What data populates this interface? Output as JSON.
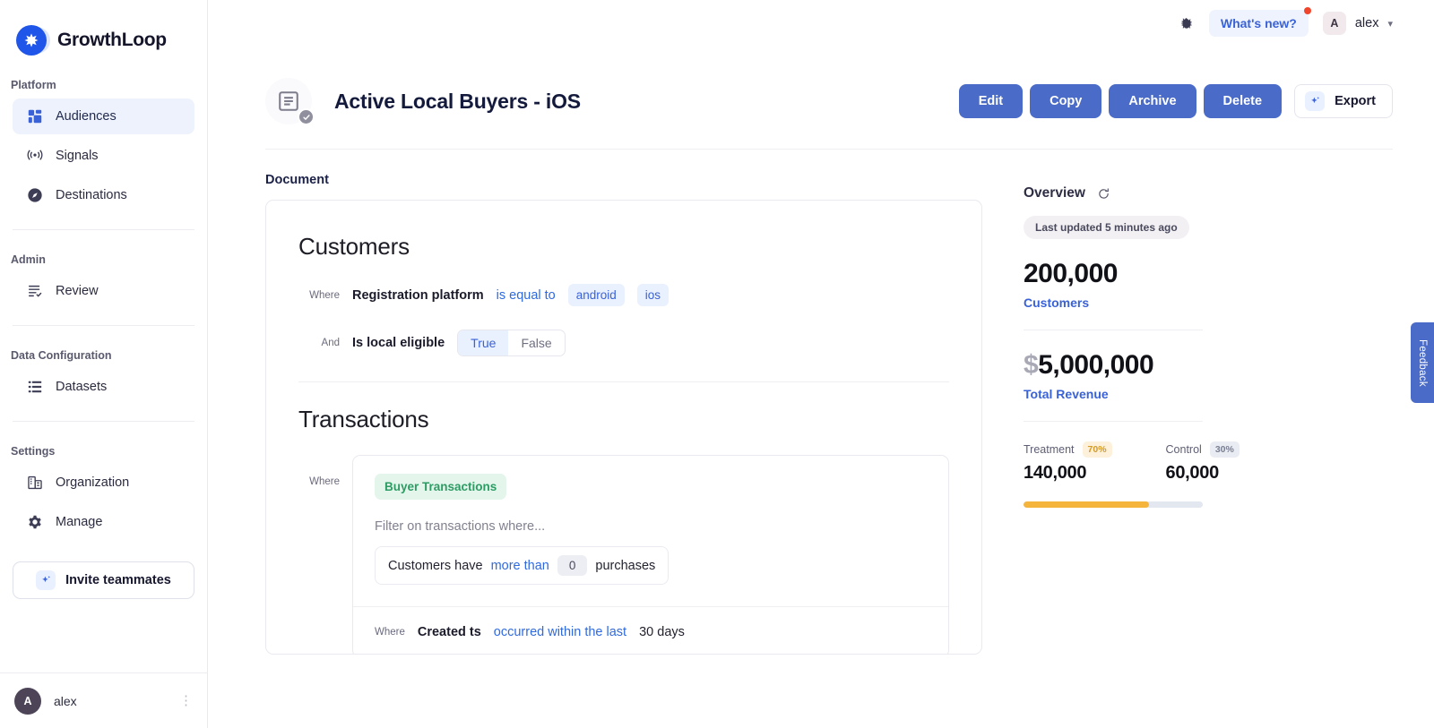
{
  "brand": {
    "name": "GrowthLoop",
    "logo_icon": "sparkle-icon"
  },
  "sidebar": {
    "sections": [
      {
        "label": "Platform",
        "items": [
          {
            "label": "Audiences",
            "icon": "grid-icon",
            "active": true
          },
          {
            "label": "Signals",
            "icon": "broadcast-icon",
            "active": false
          },
          {
            "label": "Destinations",
            "icon": "compass-icon",
            "active": false
          }
        ]
      },
      {
        "label": "Admin",
        "items": [
          {
            "label": "Review",
            "icon": "checklist-icon",
            "active": false
          }
        ]
      },
      {
        "label": "Data Configuration",
        "items": [
          {
            "label": "Datasets",
            "icon": "list-icon",
            "active": false
          }
        ]
      },
      {
        "label": "Settings",
        "items": [
          {
            "label": "Organization",
            "icon": "building-icon",
            "active": false
          },
          {
            "label": "Manage",
            "icon": "gear-icon",
            "active": false
          }
        ]
      }
    ],
    "invite_label": "Invite teammates",
    "footer_user": {
      "initial": "A",
      "name": "alex"
    }
  },
  "topbar": {
    "bug_icon": "bug-icon",
    "whats_new_label": "What's new?",
    "user": {
      "initial": "A",
      "name": "alex"
    }
  },
  "page": {
    "title": "Active Local Buyers - iOS",
    "doc_icon": "document-icon",
    "status_icon": "check-circle-icon",
    "actions": [
      {
        "label": "Edit",
        "style": "primary"
      },
      {
        "label": "Copy",
        "style": "primary"
      },
      {
        "label": "Archive",
        "style": "primary"
      },
      {
        "label": "Delete",
        "style": "primary"
      }
    ],
    "export_label": "Export"
  },
  "document": {
    "section_label": "Document",
    "customers": {
      "title": "Customers",
      "conditions": [
        {
          "keyword": "Where",
          "field": "Registration platform",
          "operator": "is equal to",
          "values": [
            "android",
            "ios"
          ]
        },
        {
          "keyword": "And",
          "field": "Is local eligible",
          "toggle": {
            "on": "True",
            "off": "False",
            "selected": "True"
          }
        }
      ]
    },
    "transactions": {
      "title": "Transactions",
      "keyword": "Where",
      "entity_pill": "Buyer Transactions",
      "filter_hint": "Filter on transactions where...",
      "inner_filter": {
        "prefix": "Customers have",
        "operator": "more than",
        "value": "0",
        "suffix": "purchases"
      },
      "footer": {
        "keyword": "Where",
        "field": "Created ts",
        "operator": "occurred within the last",
        "value": "30 days"
      }
    }
  },
  "overview": {
    "title": "Overview",
    "refresh_icon": "refresh-icon",
    "last_updated": "Last updated 5 minutes ago",
    "metrics": [
      {
        "value": "200,000",
        "currency": "",
        "label": "Customers"
      },
      {
        "value": "5,000,000",
        "currency": "$",
        "label": "Total Revenue"
      }
    ],
    "split": {
      "treatment": {
        "label": "Treatment",
        "percent": "70%",
        "value": "140,000"
      },
      "control": {
        "label": "Control",
        "percent": "30%",
        "value": "60,000"
      },
      "treatment_fraction": 70,
      "bar_color": "#f5b53c",
      "bar_track_color": "#e3e7ef"
    }
  },
  "feedback": {
    "label": "Feedback"
  }
}
